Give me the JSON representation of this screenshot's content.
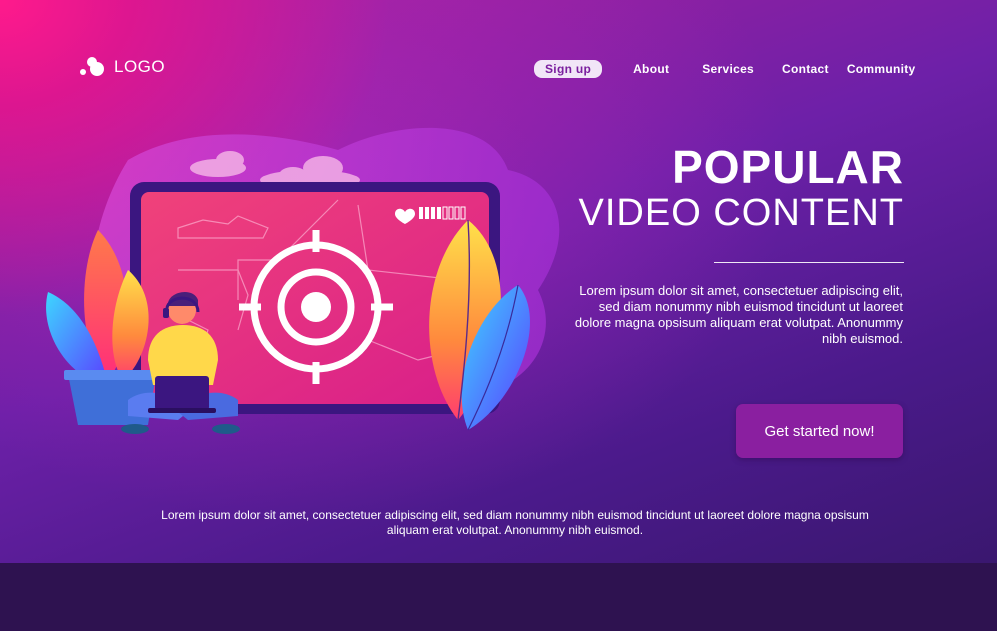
{
  "header": {
    "logo_text": "LOGO",
    "nav": {
      "signup": "Sign up",
      "about": "About",
      "services": "Services",
      "contact": "Contact",
      "community": "Community"
    }
  },
  "hero": {
    "title_line1": "POPULAR",
    "title_line2": "VIDEO CONTENT",
    "description": "Lorem ipsum dolor sit amet, consectetuer adipiscing elit, sed diam nonummy nibh euismod tincidunt ut laoreet dolore magna opsisum aliquam erat volutpat. Anonummy nibh euismod.",
    "cta_label": "Get started now!"
  },
  "footer": {
    "text": "Lorem ipsum dolor sit amet, consectetuer adipiscing elit, sed diam nonummy nibh euismod tincidunt ut laoreet dolore magna opsisum aliquam erat volutpat. Anonummy nibh euismod."
  },
  "illustration": {
    "icons": [
      "target-icon",
      "heart-icon",
      "battery-icon",
      "laptop-icon",
      "headset-icon",
      "cloud-icon",
      "leaf-icon"
    ]
  },
  "colors": {
    "accent_pink": "#ff1a8c",
    "deep_purple": "#2e1250",
    "button": "#8a1fa0",
    "signup_bg": "#f1e6f7"
  }
}
